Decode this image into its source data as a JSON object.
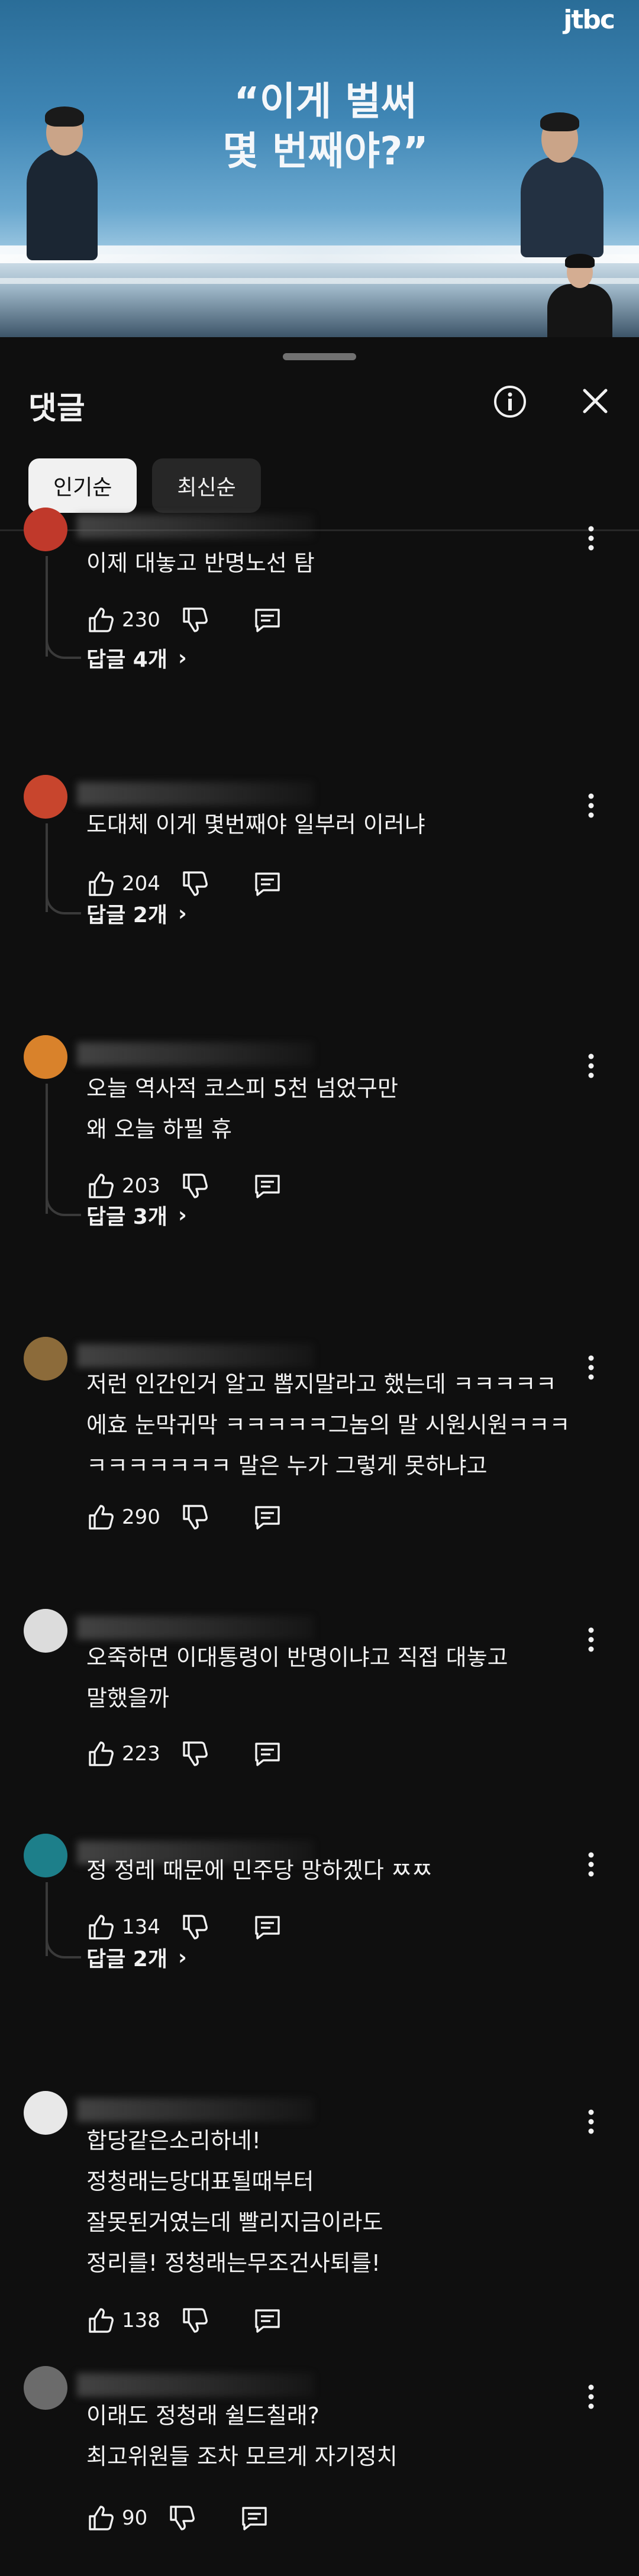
{
  "video": {
    "channel_logo": "jtbc",
    "quote_line1": "“이게 벌써",
    "quote_line2": "몇 번째야?”"
  },
  "panel": {
    "title": "댓글",
    "info_icon": "info-icon",
    "close_icon": "close-icon",
    "sort_chips": [
      {
        "label": "인기순",
        "active": true
      },
      {
        "label": "최신순",
        "active": false
      }
    ]
  },
  "comments": [
    {
      "avatar_color": "#c0392b",
      "text": "이제 대놓고 반명노선 탐",
      "likes": "230",
      "replies": "답글 4개"
    },
    {
      "avatar_color": "#c8452d",
      "text": "도대체 이게 몇번째야 일부러 이러냐",
      "likes": "204",
      "replies": "답글 2개"
    },
    {
      "avatar_color": "#d9822b",
      "text": "오늘 역사적 코스피 5천 넘었구만\n왜 오늘 하필 휴",
      "likes": "203",
      "replies": "답글 3개"
    },
    {
      "avatar_color": "#8c6b3a",
      "text": "저런 인간인거 알고 뽑지말라고 했는데 ㅋㅋㅋㅋㅋ\n에효 눈막귀막 ㅋㅋㅋㅋㅋ그놈의 말 시원시원ㅋㅋㅋ\nㅋㅋㅋㅋㅋㅋㅋ 말은 누가 그렇게 못하냐고",
      "likes": "290",
      "replies": ""
    },
    {
      "avatar_color": "#dcdcdc",
      "text": "오죽하면 이대통령이 반명이냐고 직접 대놓고\n말했을까",
      "likes": "223",
      "replies": ""
    },
    {
      "avatar_color": "#1d7f8a",
      "text": "정 정레 때문에 민주당 망하겠다 ㅉㅉ",
      "likes": "134",
      "replies": "답글 2개"
    },
    {
      "avatar_color": "#e8e8e8",
      "text": "합당같은소리하네!\n정청래는당대표될때부터\n잘못된거였는데 빨리지금이라도\n정리를! 정청래는무조건사퇴를!",
      "likes": "138",
      "replies": ""
    },
    {
      "avatar_color": "#6b6b6b",
      "text": "이래도 정청래 쉴드칠래?\n최고위원들 조차 모르게 자기정치",
      "likes": "90",
      "replies": ""
    }
  ]
}
